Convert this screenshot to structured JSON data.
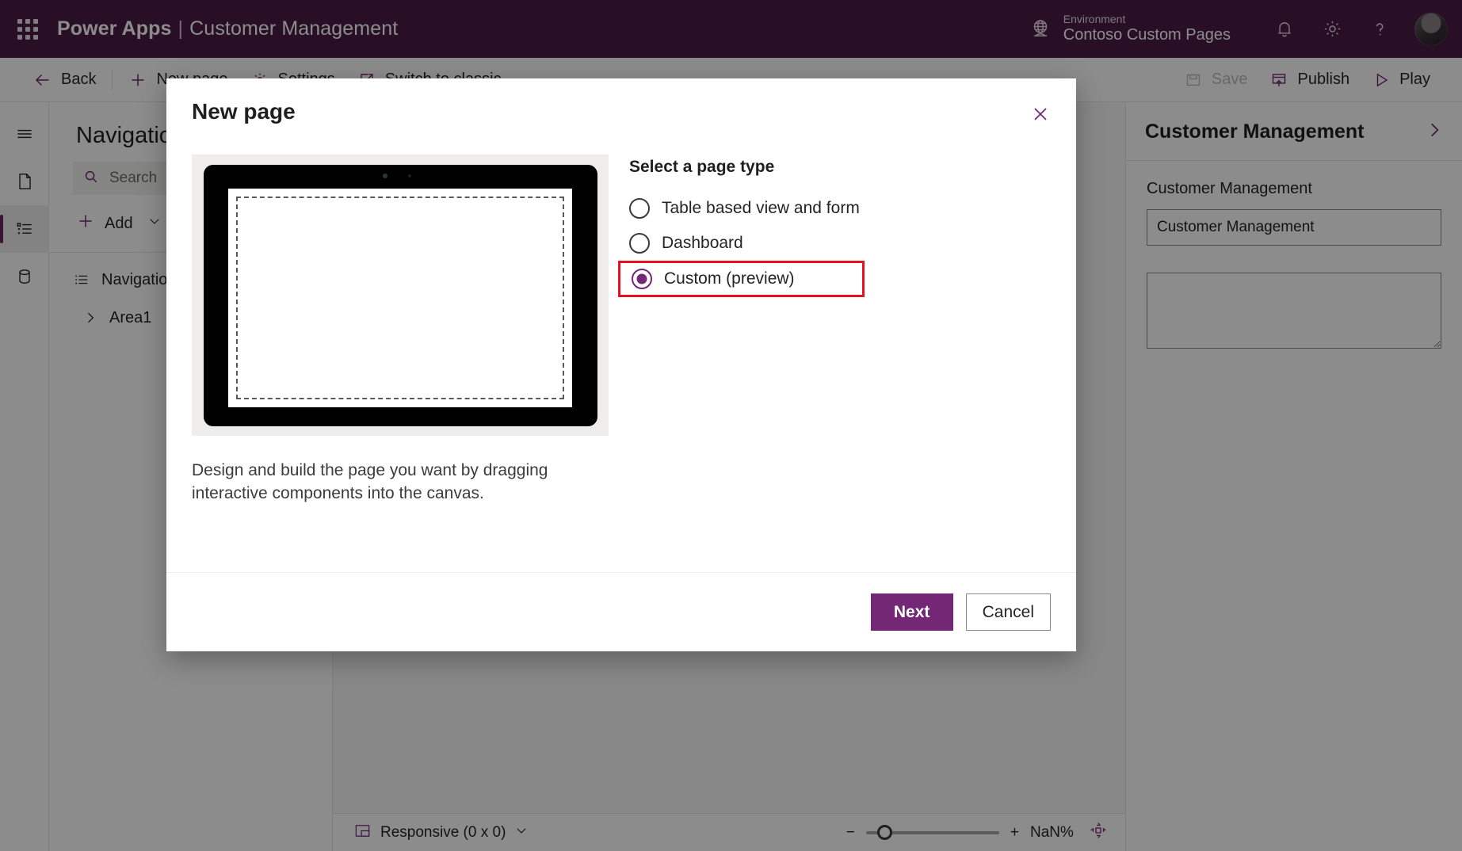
{
  "header": {
    "waffle_label": "app-launcher",
    "brand": "Power Apps",
    "separator": "|",
    "app_name": "Customer Management",
    "environment_label": "Environment",
    "environment_value": "Contoso Custom Pages"
  },
  "commandbar": {
    "back": "Back",
    "new_page": "New page",
    "settings": "Settings",
    "switch_to_classic": "Switch to classic",
    "save": "Save",
    "publish": "Publish",
    "play": "Play"
  },
  "navpanel": {
    "title": "Navigation",
    "search_placeholder": "Search",
    "search_value": "",
    "add": "Add",
    "tree": [
      {
        "label": "Navigation",
        "level": 0
      },
      {
        "label": "Area1",
        "level": 1
      }
    ]
  },
  "rightpanel": {
    "title": "Customer Management",
    "field_label": "Customer Management",
    "field_value": "Customer Management",
    "textarea_value": ""
  },
  "statusbar": {
    "screen_size": "Responsive (0 x 0)",
    "zoom_percent": "NaN%",
    "minus": "−",
    "plus": "+"
  },
  "dialog": {
    "title": "New page",
    "close_label": "Close",
    "options_title": "Select a page type",
    "page_types": [
      {
        "label": "Table based view and form",
        "selected": false,
        "highlighted": false
      },
      {
        "label": "Dashboard",
        "selected": false,
        "highlighted": false
      },
      {
        "label": "Custom (preview)",
        "selected": true,
        "highlighted": true
      }
    ],
    "description": "Design and build the page you want by dragging interactive components into the canvas.",
    "next": "Next",
    "cancel": "Cancel"
  },
  "colors": {
    "brand_purple": "#4b1c46",
    "accent_purple": "#742774",
    "highlight_red": "#e81123"
  }
}
